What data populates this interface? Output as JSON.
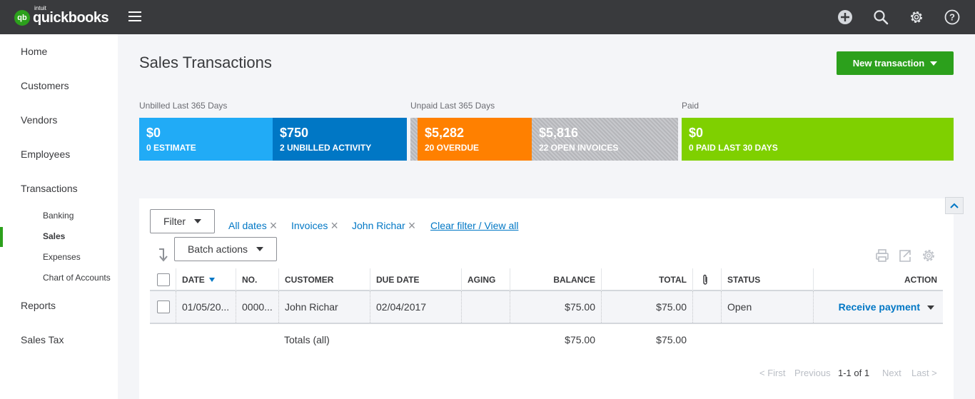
{
  "brand": {
    "badge": "qb",
    "intuit": "intuit",
    "name": "quickbooks"
  },
  "top_icons": [
    "plus-icon",
    "search-icon",
    "gear-icon",
    "help-icon"
  ],
  "sidebar": {
    "items": [
      {
        "label": "Home"
      },
      {
        "label": "Customers"
      },
      {
        "label": "Vendors"
      },
      {
        "label": "Employees"
      },
      {
        "label": "Transactions"
      }
    ],
    "sub_items": [
      {
        "label": "Banking"
      },
      {
        "label": "Sales",
        "active": true
      },
      {
        "label": "Expenses"
      },
      {
        "label": "Chart of Accounts"
      }
    ],
    "bottom_items": [
      {
        "label": "Reports"
      },
      {
        "label": "Sales Tax"
      }
    ]
  },
  "page": {
    "title": "Sales Transactions",
    "new_transaction": "New transaction"
  },
  "money_bar": {
    "groups": [
      "Unbilled Last 365 Days",
      "Unpaid Last 365 Days",
      "Paid"
    ],
    "tiles": [
      {
        "amount": "$0",
        "label": "0 ESTIMATE",
        "color": "#21abf6"
      },
      {
        "amount": "$750",
        "label": "2 UNBILLED ACTIVITY",
        "color": "#0077c5"
      },
      {
        "amount": "$5,282",
        "label": "20 OVERDUE",
        "color": "#ff8000"
      },
      {
        "amount": "$5,816",
        "label": "22 OPEN INVOICES",
        "color": "#bfc0c4"
      },
      {
        "amount": "$0",
        "label": "0 PAID LAST 30 DAYS",
        "color": "#7fd000"
      }
    ]
  },
  "filters": {
    "filter_label": "Filter",
    "chips": [
      "All dates",
      "Invoices",
      "John Richar"
    ],
    "clear_label": "Clear filter / View all",
    "batch_label": "Batch actions"
  },
  "table": {
    "headers": {
      "date": "DATE",
      "no": "NO.",
      "customer": "CUSTOMER",
      "due_date": "DUE DATE",
      "aging": "AGING",
      "balance": "BALANCE",
      "total": "TOTAL",
      "status": "STATUS",
      "action": "ACTION"
    },
    "rows": [
      {
        "date": "01/05/20...",
        "no": "0000...",
        "customer": "John Richar",
        "due_date": "02/04/2017",
        "aging": "",
        "balance": "$75.00",
        "total": "$75.00",
        "status": "Open",
        "action": "Receive payment"
      }
    ],
    "totals": {
      "label": "Totals (all)",
      "balance": "$75.00",
      "total": "$75.00"
    }
  },
  "pagination": {
    "first": "< First",
    "previous": "Previous",
    "range": "1-1 of 1",
    "next": "Next",
    "last": "Last >"
  }
}
